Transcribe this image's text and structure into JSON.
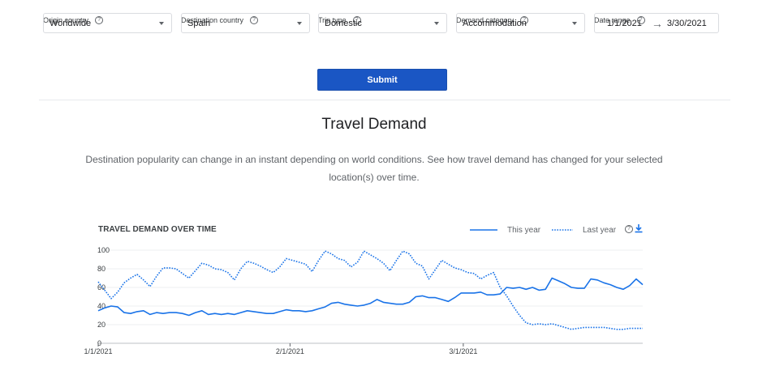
{
  "filters": {
    "origin": {
      "label": "Origin country",
      "value": "Worldwide"
    },
    "destination": {
      "label": "Destination country",
      "value": "Spain"
    },
    "trip_type": {
      "label": "Trip type",
      "value": "Domestic"
    },
    "demand_category": {
      "label": "Demand category",
      "value": "Accommodation"
    },
    "date_range": {
      "label": "Date range",
      "start": "1/1/2021",
      "end": "3/30/2021"
    }
  },
  "submit_label": "Submit",
  "section_title": "Travel Demand",
  "description": "Destination popularity can change in an instant depending on world conditions. See how travel demand has changed for your selected location(s) over time.",
  "colors": {
    "accent": "#1a73e8",
    "button": "#1a56c4"
  },
  "icons": {
    "help": "help-circle-icon",
    "download": "download-icon",
    "dropdown": "chevron-down-icon",
    "arrow": "arrow-right-icon"
  },
  "chart_data": {
    "type": "line",
    "title": "TRAVEL DEMAND OVER TIME",
    "ylim": [
      0,
      100
    ],
    "yticks": [
      0,
      20,
      40,
      60,
      80,
      100
    ],
    "xticks": [
      "1/1/2021",
      "2/1/2021",
      "3/1/2021"
    ],
    "x_start": "1/1/2021",
    "x_end": "3/30/2021",
    "grid": true,
    "legend": "top-right",
    "series": [
      {
        "name": "This year",
        "style": "solid",
        "values": [
          35,
          38,
          40,
          39,
          33,
          32,
          34,
          35,
          31,
          33,
          32,
          33,
          33,
          32,
          30,
          33,
          35,
          31,
          32,
          31,
          32,
          31,
          33,
          35,
          34,
          33,
          32,
          32,
          34,
          36,
          35,
          35,
          34,
          35,
          37,
          39,
          43,
          44,
          42,
          41,
          40,
          41,
          43,
          47,
          44,
          43,
          42,
          42,
          44,
          50,
          51,
          49,
          49,
          47,
          45,
          49,
          54,
          54,
          54,
          55,
          52,
          52,
          53,
          60,
          59,
          60,
          58,
          60,
          57,
          58,
          70,
          67,
          64,
          60,
          59,
          59,
          69,
          68,
          65,
          63,
          60,
          58,
          62,
          69,
          63
        ]
      },
      {
        "name": "Last year",
        "style": "dotted",
        "values": [
          66,
          57,
          48,
          55,
          65,
          70,
          74,
          68,
          61,
          72,
          81,
          81,
          80,
          75,
          70,
          78,
          86,
          84,
          80,
          79,
          76,
          68,
          80,
          88,
          86,
          83,
          79,
          76,
          82,
          91,
          89,
          87,
          85,
          77,
          89,
          99,
          96,
          91,
          89,
          82,
          87,
          99,
          95,
          91,
          86,
          78,
          89,
          99,
          96,
          86,
          83,
          69,
          79,
          89,
          85,
          81,
          79,
          76,
          75,
          69,
          73,
          76,
          60,
          51,
          40,
          30,
          22,
          20,
          21,
          20,
          21,
          19,
          17,
          15,
          16,
          17,
          17,
          17,
          17,
          16,
          15,
          15,
          16,
          16,
          16
        ]
      }
    ]
  }
}
